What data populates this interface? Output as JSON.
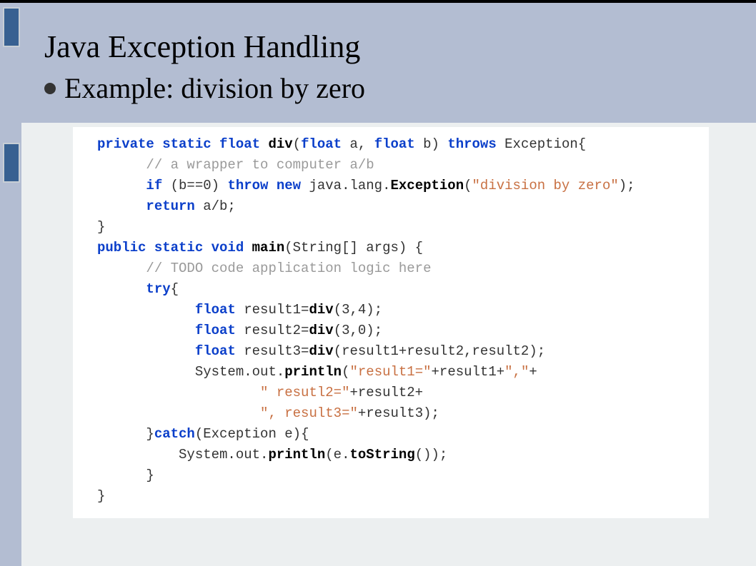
{
  "title": "Java Exception Handling",
  "subtitle": "Example: division by zero",
  "code": {
    "l1a": "private static float ",
    "l1b": "div",
    "l1c": "(",
    "l1d": "float",
    "l1e": " a, ",
    "l1f": "float",
    "l1g": " b) ",
    "l1h": "throws",
    "l1i": " Exception{",
    "l2": "      // a wrapper to computer a/b",
    "l3a": "      if",
    "l3b": " (b==0) ",
    "l3c": "throw new",
    "l3d": " java.lang.",
    "l3e": "Exception",
    "l3f": "(",
    "l3g": "\"division by zero\"",
    "l3h": ");",
    "l4a": "      return",
    "l4b": " a/b;",
    "l5": "}",
    "l6a": "public static void ",
    "l6b": "main",
    "l6c": "(String[] args) {",
    "l7": "      // TODO code application logic here",
    "l8a": "      try",
    "l8b": "{",
    "l9a": "            float",
    "l9b": " result1=",
    "l9c": "div",
    "l9d": "(3,4);",
    "l10a": "            float",
    "l10b": " result2=",
    "l10c": "div",
    "l10d": "(3,0);",
    "l11a": "            float",
    "l11b": " result3=",
    "l11c": "div",
    "l11d": "(result1+result2,result2);",
    "l12a": "            System.out.",
    "l12b": "println",
    "l12c": "(",
    "l12d": "\"result1=\"",
    "l12e": "+result1+",
    "l12f": "\",\"",
    "l12g": "+",
    "l13a": "                    ",
    "l13b": "\" resutl2=\"",
    "l13c": "+result2+",
    "l14a": "                    ",
    "l14b": "\", result3=\"",
    "l14c": "+result3);",
    "l15a": "      }",
    "l15b": "catch",
    "l15c": "(Exception e){",
    "l16a": "          System.out.",
    "l16b": "println",
    "l16c": "(e.",
    "l16d": "toString",
    "l16e": "());",
    "l17": "      }",
    "l18": "}"
  }
}
